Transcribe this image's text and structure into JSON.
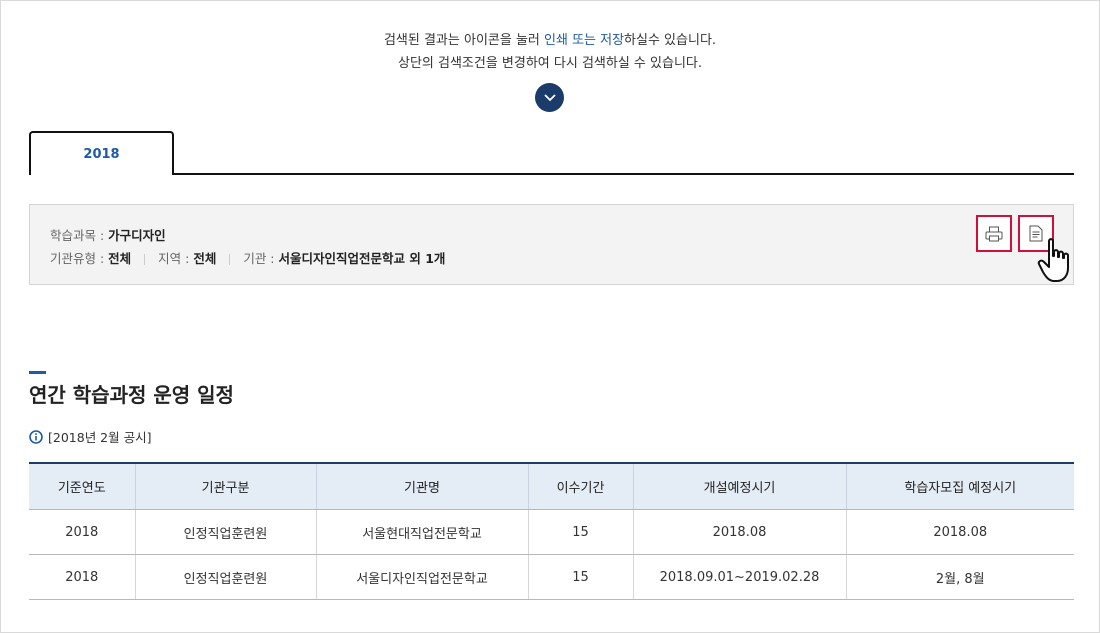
{
  "notice": {
    "line1_pre": "검색된 결과는 아이콘을 눌러 ",
    "line1_hl": "인쇄 또는 저장",
    "line1_post": "하실수 있습니다.",
    "line2": "상단의 검색조건을 변경하여 다시 검색하실 수 있습니다."
  },
  "tab": {
    "label": "2018"
  },
  "summary": {
    "course_label": "학습과목 : ",
    "course_value": "가구디자인",
    "org_type_label": "기관유형 : ",
    "org_type_value": "전체",
    "region_label": "지역 : ",
    "region_value": "전체",
    "org_label": "기관 : ",
    "org_value": "서울디자인직업전문학교 외 1개"
  },
  "icons": {
    "print": "printer-icon",
    "save": "document-icon",
    "cursor": "hand-pointer-icon",
    "toggle": "chevron-down-icon",
    "info": "info-icon"
  },
  "section": {
    "title": "연간 학습과정 운영 일정",
    "notice": "[2018년 2월 공시]"
  },
  "table": {
    "headers": [
      "기준연도",
      "기관구분",
      "기관명",
      "이수기간",
      "개설예정시기",
      "학습자모집 예정시기"
    ],
    "rows": [
      [
        "2018",
        "인정직업훈련원",
        "서울현대직업전문학교",
        "15",
        "2018.08",
        "2018.08"
      ],
      [
        "2018",
        "인정직업훈련원",
        "서울디자인직업전문학교",
        "15",
        "2018.09.01~2019.02.28",
        "2월, 8월"
      ]
    ]
  },
  "colors": {
    "accent": "#1f5aa6",
    "navy": "#1b3b6b",
    "highlight_border": "#d0103a",
    "header_bg": "#e4ecf5"
  }
}
